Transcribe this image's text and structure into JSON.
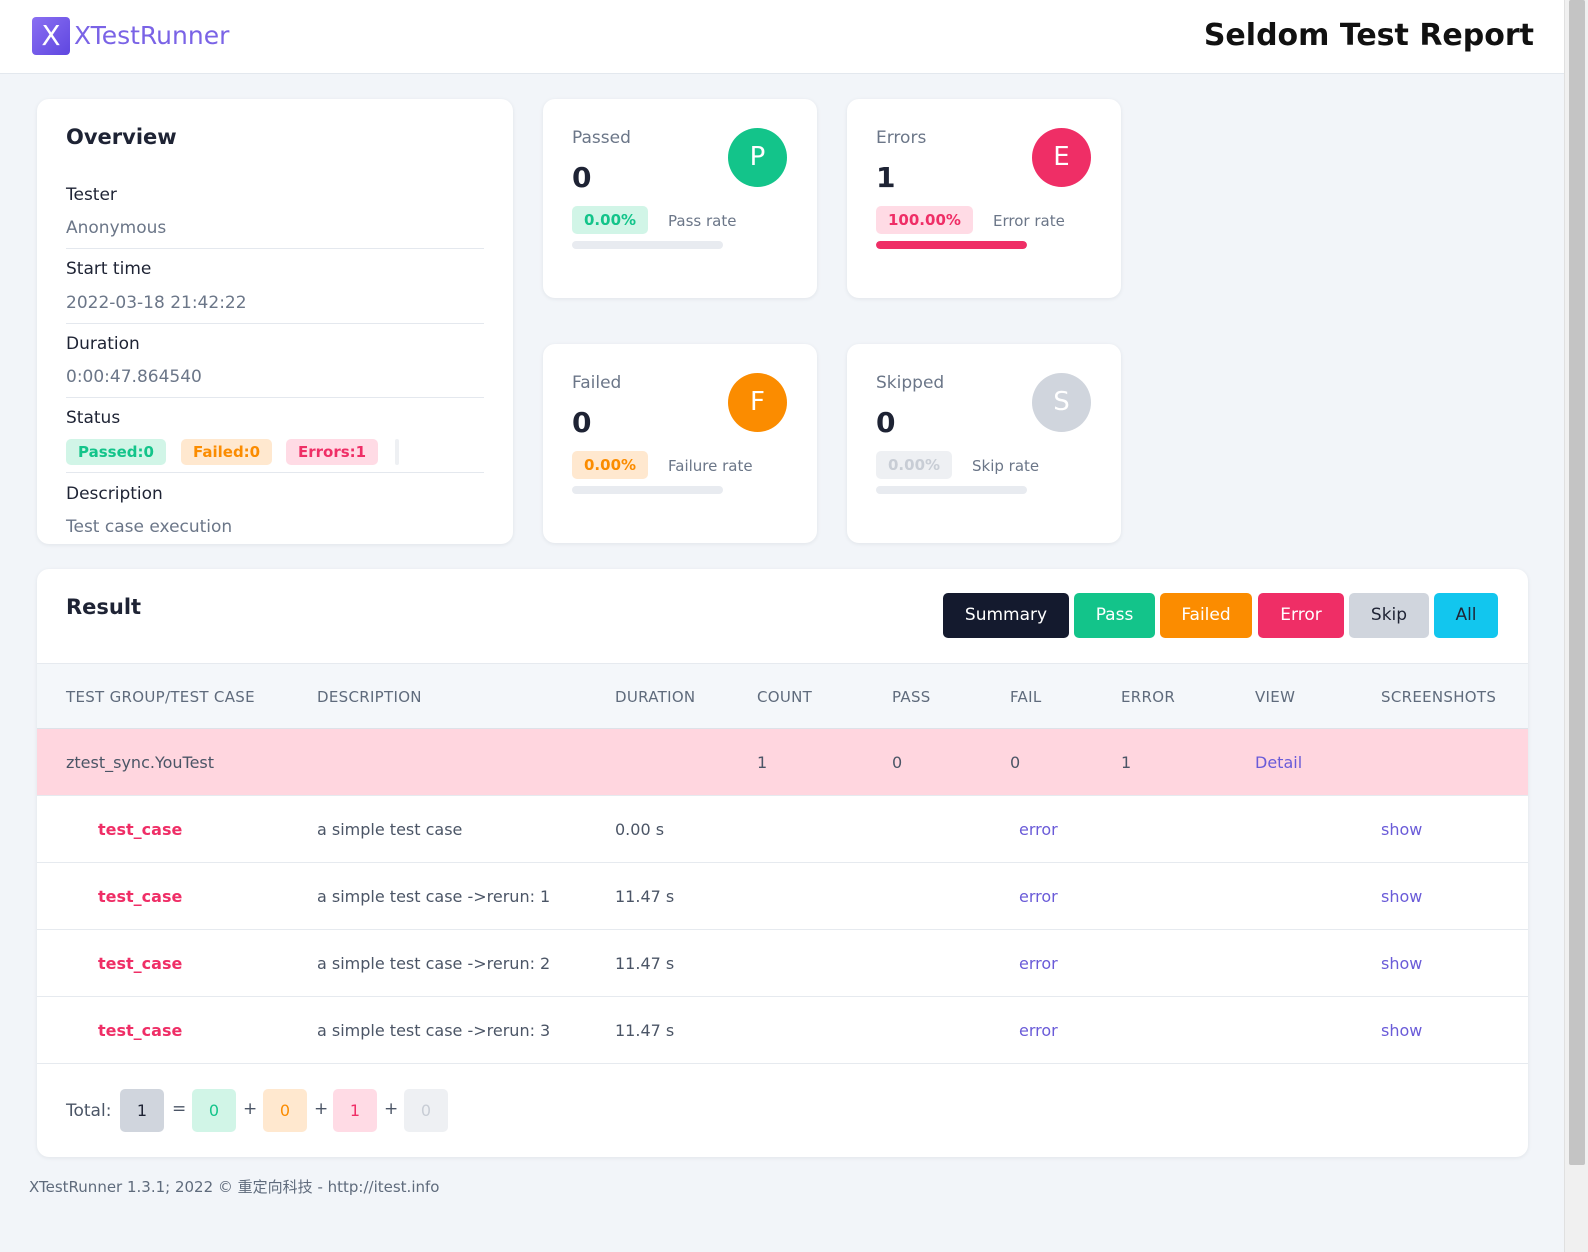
{
  "header": {
    "logo_letter": "X",
    "logo_text": "XTestRunner",
    "title": "Seldom Test Report"
  },
  "overview": {
    "title": "Overview",
    "tester_label": "Tester",
    "tester": "Anonymous",
    "start_label": "Start time",
    "start": "2022-03-18 21:42:22",
    "duration_label": "Duration",
    "duration": "0:00:47.864540",
    "status_label": "Status",
    "status": {
      "passed": "Passed:0",
      "failed": "Failed:0",
      "errors": "Errors:1"
    },
    "description_label": "Description",
    "description": "Test case execution"
  },
  "stats": {
    "passed": {
      "label": "Passed",
      "count": "0",
      "letter": "P",
      "pct": "0.00%",
      "rate_label": "Pass rate",
      "fraction": 0.0
    },
    "errors": {
      "label": "Errors",
      "count": "1",
      "letter": "E",
      "pct": "100.00%",
      "rate_label": "Error rate",
      "fraction": 1.0
    },
    "failed": {
      "label": "Failed",
      "count": "0",
      "letter": "F",
      "pct": "0.00%",
      "rate_label": "Failure rate",
      "fraction": 0.0
    },
    "skipped": {
      "label": "Skipped",
      "count": "0",
      "letter": "S",
      "pct": "0.00%",
      "rate_label": "Skip rate",
      "fraction": 0.0
    }
  },
  "result": {
    "title": "Result",
    "filters": [
      "Summary",
      "Pass",
      "Failed",
      "Error",
      "Skip",
      "All"
    ],
    "columns": [
      "TEST GROUP/TEST CASE",
      "DESCRIPTION",
      "DURATION",
      "COUNT",
      "PASS",
      "FAIL",
      "ERROR",
      "VIEW",
      "SCREENSHOTS"
    ],
    "group": {
      "name": "ztest_sync.YouTest",
      "count": "1",
      "pass": "0",
      "fail": "0",
      "error": "1",
      "view": "Detail"
    },
    "cases": [
      {
        "name": "test_case",
        "description": "a simple test case",
        "duration": "0.00 s",
        "status": "error",
        "screenshot": "show"
      },
      {
        "name": "test_case",
        "description": "a simple test case ->rerun: 1",
        "duration": "11.47 s",
        "status": "error",
        "screenshot": "show"
      },
      {
        "name": "test_case",
        "description": "a simple test case ->rerun: 2",
        "duration": "11.47 s",
        "status": "error",
        "screenshot": "show"
      },
      {
        "name": "test_case",
        "description": "a simple test case ->rerun: 3",
        "duration": "11.47 s",
        "status": "error",
        "screenshot": "show"
      }
    ],
    "total": {
      "label": "Total:",
      "all": "1",
      "pass": "0",
      "fail": "0",
      "error": "1",
      "skip": "0",
      "eq": "=",
      "plus": "+"
    }
  },
  "footer": "XTestRunner 1.3.1; 2022 © 重定向科技 - http://itest.info",
  "colors": {
    "pass": "#13c48a",
    "failed": "#fb8c00",
    "error": "#ef2e66",
    "skip": "#d0d5dd",
    "all": "#12c6ee",
    "summary": "#141a2e"
  }
}
